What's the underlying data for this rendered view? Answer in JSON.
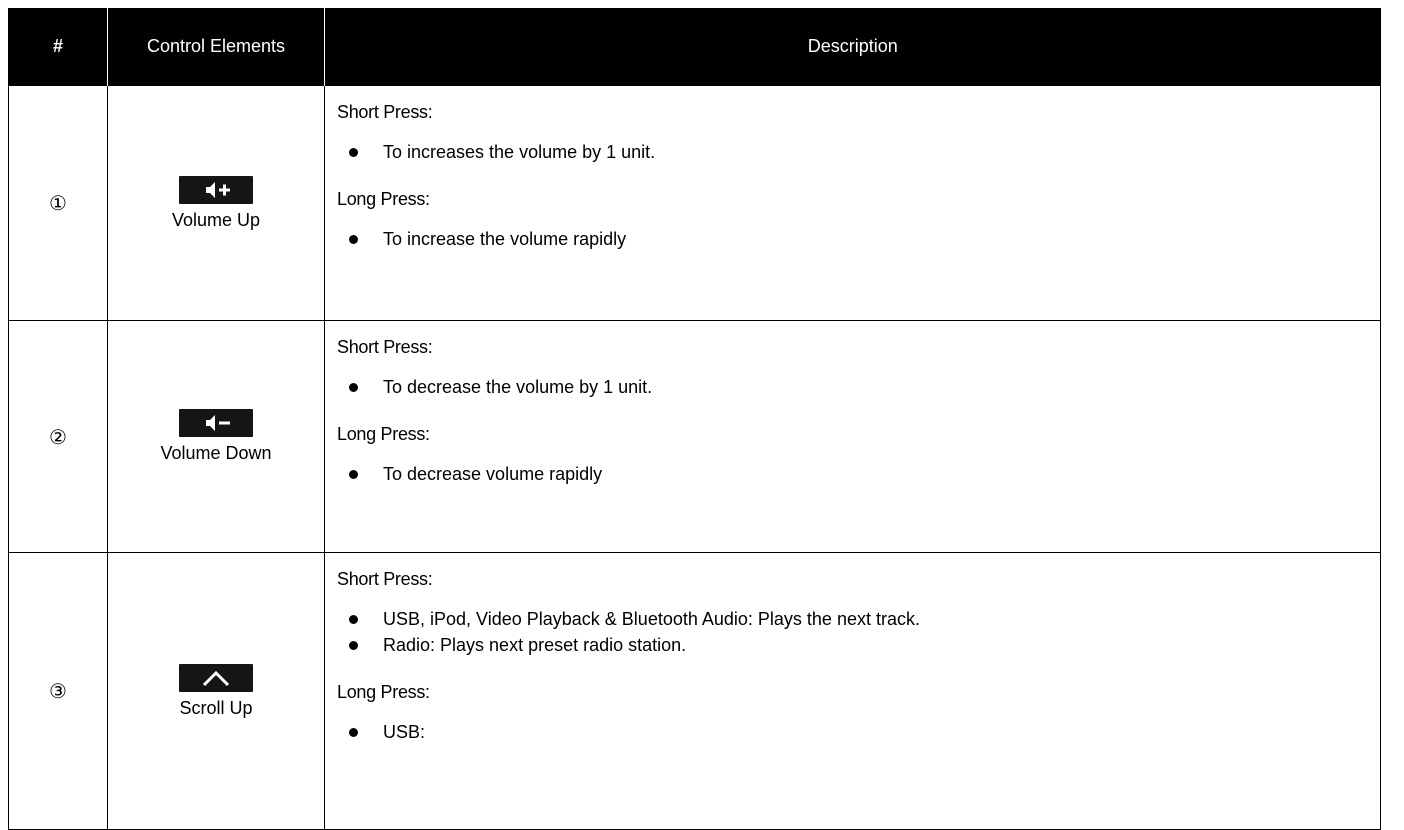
{
  "table": {
    "headers": {
      "num": "#",
      "control": "Control Elements",
      "description": "Description"
    },
    "rows": [
      {
        "num": "①",
        "icon": "volume-up-icon",
        "label": "Volume Up",
        "short_title": "Short Press:",
        "short_items": [
          "To increases the volume by 1 unit."
        ],
        "long_title": "Long Press:",
        "long_items": [
          "To increase the volume rapidly"
        ]
      },
      {
        "num": "②",
        "icon": "volume-down-icon",
        "label": "Volume Down",
        "short_title": "Short Press:",
        "short_items": [
          "To decrease the volume by 1 unit."
        ],
        "long_title": "Long Press:",
        "long_items": [
          "To decrease volume rapidly"
        ]
      },
      {
        "num": "③",
        "icon": "scroll-up-icon",
        "label": "Scroll Up",
        "short_title": "Short Press:",
        "short_items": [
          "USB, iPod, Video Playback & Bluetooth Audio: Plays the next track.",
          "Radio: Plays next preset radio station."
        ],
        "long_title": "Long Press:",
        "long_items": [
          "USB:"
        ]
      }
    ]
  }
}
